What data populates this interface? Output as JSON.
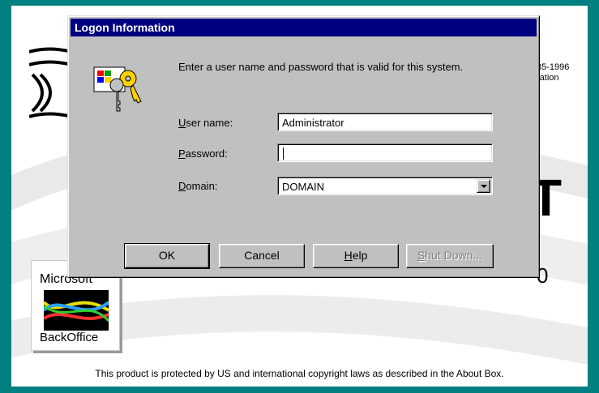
{
  "splash": {
    "copyright_fragment": "35-1996\nration",
    "logo_fragment": "T",
    "version_fragment": "0",
    "backoffice_top": "Microsoft",
    "backoffice_bottom": "BackOffice",
    "legal_text": "This product is protected by US and international copyright laws as described in the About Box."
  },
  "dialog": {
    "title": "Logon Information",
    "prompt": "Enter a user name and password that is valid for this system.",
    "fields": {
      "username": {
        "label": "User name:",
        "accel": "U",
        "rest": "ser name:",
        "value": "Administrator"
      },
      "password": {
        "label": "Password:",
        "accel": "P",
        "rest": "assword:",
        "value": ""
      },
      "domain": {
        "label": "Domain:",
        "accel": "D",
        "rest": "omain:",
        "value": "DOMAIN"
      }
    },
    "buttons": {
      "ok": "OK",
      "cancel": "Cancel",
      "help_accel": "H",
      "help_rest": "elp",
      "shutdown_accel": "S",
      "shutdown_rest": "hut Down..."
    }
  },
  "colors": {
    "desktop": "#008080",
    "titlebar": "#000080",
    "dialog_face": "#c0c0c0"
  },
  "icons": [
    "keys-computer-icon",
    "chevron-down-icon",
    "backoffice-logo-icon",
    "windows-nt-logo-icon"
  ]
}
